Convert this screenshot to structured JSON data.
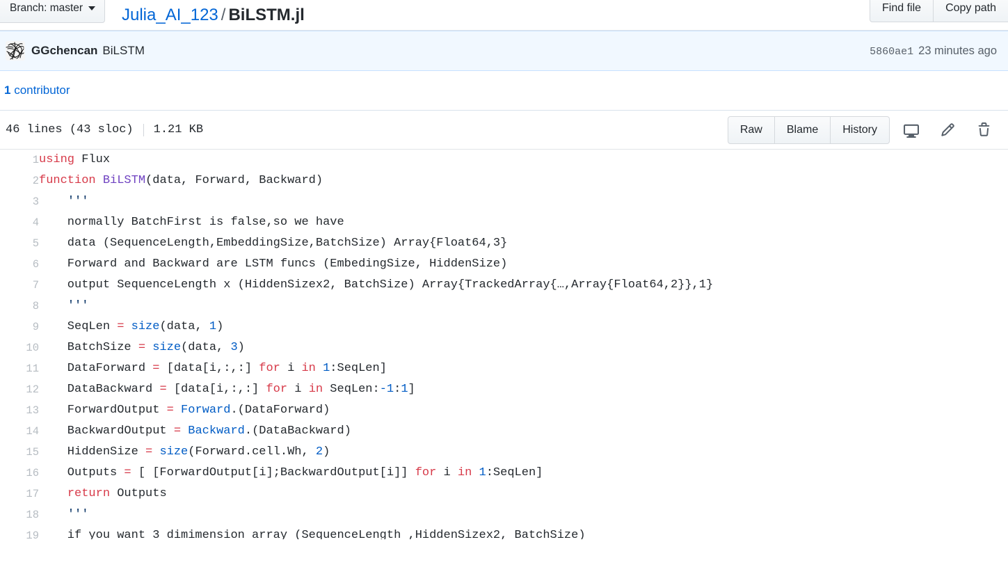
{
  "pathbar": {
    "branch_label": "Branch: master",
    "caret_icon": "chevron-down-icon",
    "repo": "Julia_AI_123",
    "separator": "/",
    "filename": "BiLSTM.jl",
    "find_file_label": "Find file",
    "copy_path_label": "Copy path"
  },
  "commit": {
    "avatar_icon": "user-avatar-identicon",
    "author": "GGchencan",
    "message": "BiLSTM",
    "sha": "5860ae1",
    "time": "23 minutes ago"
  },
  "contributors": {
    "count": "1",
    "label": " contributor"
  },
  "filemeta": {
    "lines": "46 lines (43 sloc)",
    "size": "1.21 KB",
    "raw_label": "Raw",
    "blame_label": "Blame",
    "history_label": "History",
    "desktop_icon": "desktop-download-icon",
    "edit_icon": "pencil-icon",
    "delete_icon": "trash-icon"
  },
  "colors": {
    "link": "#0366d6",
    "keyword": "#d73a49",
    "function": "#6f42c1",
    "constant": "#005cc5",
    "string": "#032f62",
    "commit_bg": "#f1f8ff",
    "commit_border": "#c8e1ff",
    "text": "#24292e",
    "muted": "#586069"
  },
  "code": {
    "language": "julia",
    "lines": [
      {
        "n": "1",
        "tokens": [
          {
            "t": "using",
            "c": "k"
          },
          {
            "t": " Flux",
            "c": "pl"
          }
        ]
      },
      {
        "n": "2",
        "tokens": [
          {
            "t": "function ",
            "c": "k"
          },
          {
            "t": "BiLSTM",
            "c": "fn"
          },
          {
            "t": "(data, Forward, Backward)",
            "c": "pl"
          }
        ]
      },
      {
        "n": "3",
        "tokens": [
          {
            "t": "    ",
            "c": "pl"
          },
          {
            "t": "'''",
            "c": "s"
          }
        ]
      },
      {
        "n": "4",
        "tokens": [
          {
            "t": "    normally BatchFirst is false,so we have",
            "c": "pl"
          }
        ]
      },
      {
        "n": "5",
        "tokens": [
          {
            "t": "    data (SequenceLength,EmbeddingSize,BatchSize) Array{Float64,3}",
            "c": "pl"
          }
        ]
      },
      {
        "n": "6",
        "tokens": [
          {
            "t": "    Forward and Backward are LSTM funcs (EmbedingSize, HiddenSize)",
            "c": "pl"
          }
        ]
      },
      {
        "n": "7",
        "tokens": [
          {
            "t": "    output SequenceLength x (HiddenSizex2, BatchSize) Array{TrackedArray{…,Array{Float64,2}},1}",
            "c": "pl"
          }
        ]
      },
      {
        "n": "8",
        "tokens": [
          {
            "t": "    ",
            "c": "pl"
          },
          {
            "t": "'''",
            "c": "s"
          }
        ]
      },
      {
        "n": "9",
        "tokens": [
          {
            "t": "    SeqLen ",
            "c": "pl"
          },
          {
            "t": "=",
            "c": "op"
          },
          {
            "t": " ",
            "c": "pl"
          },
          {
            "t": "size",
            "c": "c"
          },
          {
            "t": "(data, ",
            "c": "pl"
          },
          {
            "t": "1",
            "c": "c"
          },
          {
            "t": ")",
            "c": "pl"
          }
        ]
      },
      {
        "n": "10",
        "tokens": [
          {
            "t": "    BatchSize ",
            "c": "pl"
          },
          {
            "t": "=",
            "c": "op"
          },
          {
            "t": " ",
            "c": "pl"
          },
          {
            "t": "size",
            "c": "c"
          },
          {
            "t": "(data, ",
            "c": "pl"
          },
          {
            "t": "3",
            "c": "c"
          },
          {
            "t": ")",
            "c": "pl"
          }
        ]
      },
      {
        "n": "11",
        "tokens": [
          {
            "t": "    DataForward ",
            "c": "pl"
          },
          {
            "t": "=",
            "c": "op"
          },
          {
            "t": " [data[i,:,:] ",
            "c": "pl"
          },
          {
            "t": "for",
            "c": "k"
          },
          {
            "t": " i ",
            "c": "pl"
          },
          {
            "t": "in",
            "c": "k"
          },
          {
            "t": " ",
            "c": "pl"
          },
          {
            "t": "1",
            "c": "c"
          },
          {
            "t": ":SeqLen]",
            "c": "pl"
          }
        ]
      },
      {
        "n": "12",
        "tokens": [
          {
            "t": "    DataBackward ",
            "c": "pl"
          },
          {
            "t": "=",
            "c": "op"
          },
          {
            "t": " [data[i,:,:] ",
            "c": "pl"
          },
          {
            "t": "for",
            "c": "k"
          },
          {
            "t": " i ",
            "c": "pl"
          },
          {
            "t": "in",
            "c": "k"
          },
          {
            "t": " SeqLen:",
            "c": "pl"
          },
          {
            "t": "-1",
            "c": "c"
          },
          {
            "t": ":",
            "c": "pl"
          },
          {
            "t": "1",
            "c": "c"
          },
          {
            "t": "]",
            "c": "pl"
          }
        ]
      },
      {
        "n": "13",
        "tokens": [
          {
            "t": "    ForwardOutput ",
            "c": "pl"
          },
          {
            "t": "=",
            "c": "op"
          },
          {
            "t": " ",
            "c": "pl"
          },
          {
            "t": "Forward",
            "c": "c"
          },
          {
            "t": ".(DataForward)",
            "c": "pl"
          }
        ]
      },
      {
        "n": "14",
        "tokens": [
          {
            "t": "    BackwardOutput ",
            "c": "pl"
          },
          {
            "t": "=",
            "c": "op"
          },
          {
            "t": " ",
            "c": "pl"
          },
          {
            "t": "Backward",
            "c": "c"
          },
          {
            "t": ".(DataBackward)",
            "c": "pl"
          }
        ]
      },
      {
        "n": "15",
        "tokens": [
          {
            "t": "    HiddenSize ",
            "c": "pl"
          },
          {
            "t": "=",
            "c": "op"
          },
          {
            "t": " ",
            "c": "pl"
          },
          {
            "t": "size",
            "c": "c"
          },
          {
            "t": "(Forward.cell.Wh, ",
            "c": "pl"
          },
          {
            "t": "2",
            "c": "c"
          },
          {
            "t": ")",
            "c": "pl"
          }
        ]
      },
      {
        "n": "16",
        "tokens": [
          {
            "t": "    Outputs ",
            "c": "pl"
          },
          {
            "t": "=",
            "c": "op"
          },
          {
            "t": " [ [ForwardOutput[i];BackwardOutput[i]] ",
            "c": "pl"
          },
          {
            "t": "for",
            "c": "k"
          },
          {
            "t": " i ",
            "c": "pl"
          },
          {
            "t": "in",
            "c": "k"
          },
          {
            "t": " ",
            "c": "pl"
          },
          {
            "t": "1",
            "c": "c"
          },
          {
            "t": ":SeqLen]",
            "c": "pl"
          }
        ]
      },
      {
        "n": "17",
        "tokens": [
          {
            "t": "    ",
            "c": "pl"
          },
          {
            "t": "return",
            "c": "k"
          },
          {
            "t": " Outputs",
            "c": "pl"
          }
        ]
      },
      {
        "n": "18",
        "tokens": [
          {
            "t": "    ",
            "c": "pl"
          },
          {
            "t": "'''",
            "c": "s"
          }
        ]
      },
      {
        "n": "19",
        "tokens": [
          {
            "t": "    if you want 3 dimimension array (SequenceLength ,HiddenSizex2, BatchSize)",
            "c": "pl"
          }
        ]
      }
    ]
  }
}
